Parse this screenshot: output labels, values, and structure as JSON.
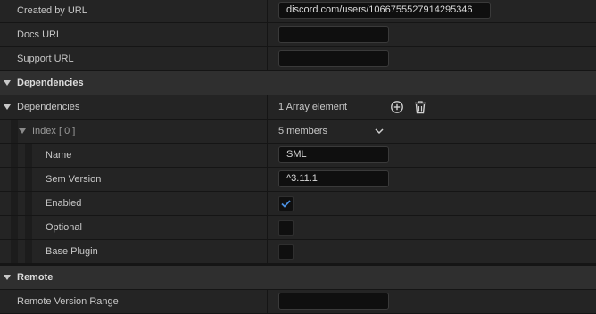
{
  "rows": {
    "created_by_url": {
      "label": "Created by URL",
      "value": "discord.com/users/1066755527914295346"
    },
    "docs_url": {
      "label": "Docs URL",
      "value": ""
    },
    "support_url": {
      "label": "Support URL",
      "value": ""
    },
    "dependencies_section": {
      "label": "Dependencies"
    },
    "dependencies": {
      "label": "Dependencies",
      "value": "1 Array element"
    },
    "index": {
      "label": "Index [ 0 ]",
      "value": "5 members"
    },
    "name": {
      "label": "Name",
      "value": "SML"
    },
    "sem_version": {
      "label": "Sem Version",
      "value": "^3.11.1"
    },
    "enabled": {
      "label": "Enabled",
      "checked": true
    },
    "optional": {
      "label": "Optional",
      "checked": false
    },
    "base_plugin": {
      "label": "Base Plugin",
      "checked": false
    },
    "remote_section": {
      "label": "Remote"
    },
    "remote_version_range": {
      "label": "Remote Version Range",
      "value": ""
    }
  },
  "icons": {
    "add": "add-element-icon",
    "delete": "trash-icon",
    "expand": "chevron-down-icon",
    "check": "checkmark-icon"
  },
  "colors": {
    "background": "#151515",
    "row": "#242424",
    "header_row": "#2f2f2f",
    "input_bg": "#0f0f0f",
    "check_accent": "#4a8fe0"
  }
}
